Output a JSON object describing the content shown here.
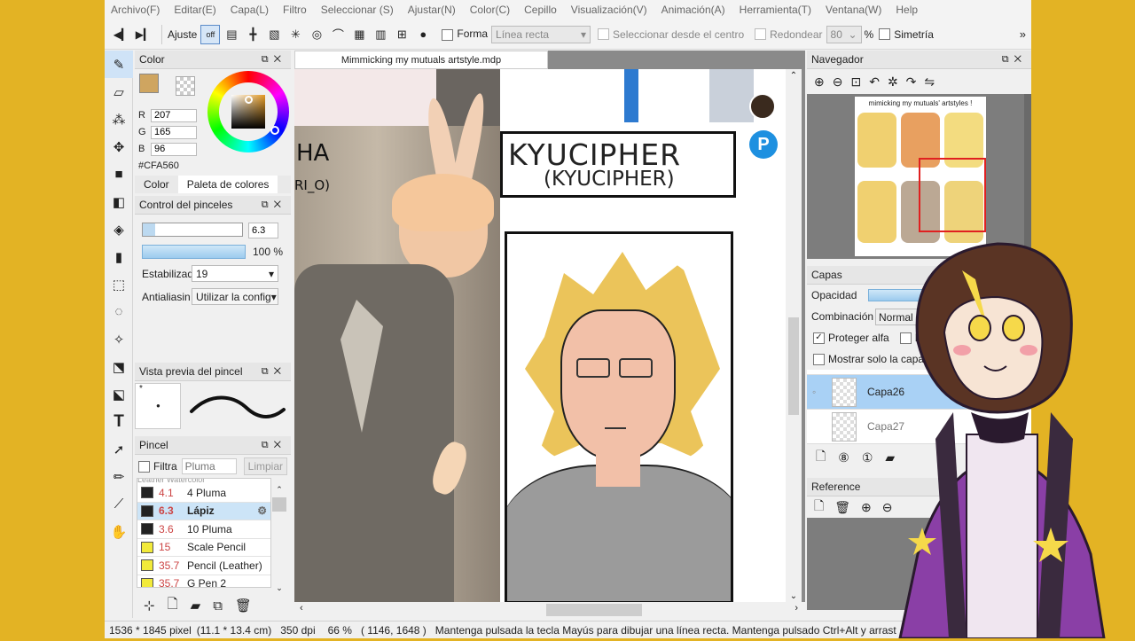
{
  "menu": [
    "Archivo(F)",
    "Editar(E)",
    "Capa(L)",
    "Filtro",
    "Seleccionar (S)",
    "Ajustar(N)",
    "Color(C)",
    "Cepillo",
    "Visualización(V)",
    "Animación(A)",
    "Herramienta(T)",
    "Ventana(W)",
    "Help"
  ],
  "toolbar": {
    "ajuste_label": "Ajuste",
    "off_label": "off",
    "forma_label": "Forma",
    "forma_value": "Línea recta",
    "select_from_center": "Seleccionar desde el centro",
    "redondear_label": "Redondear",
    "redondear_value": "80",
    "percent": "%",
    "simetria_label": "Simetría",
    "more": "»"
  },
  "document_tab": "Mimmicking my mutuals artstyle.mdp",
  "color_panel": {
    "title": "Color",
    "r_label": "R",
    "r": "207",
    "g_label": "G",
    "g": "165",
    "b_label": "B",
    "b": "96",
    "hex": "#CFA560",
    "tab_color": "Color",
    "tab_palette": "Paleta de colores",
    "fg_color": "#CFA560"
  },
  "brush_control": {
    "title": "Control del pinceles",
    "size": "6.3",
    "opacity": "100 %",
    "stabilizer_label": "Estabilizad",
    "stabilizer_value": "19",
    "antialias_label": "Antialiasin",
    "antialias_value": "Utilizar la config"
  },
  "brush_preview": {
    "title": "Vista previa del pincel"
  },
  "brush_panel": {
    "title": "Pincel",
    "filter_label": "Filtra",
    "filter_placeholder": "Pluma",
    "clear_label": "Limpiar",
    "partial_top": "Leather Watercolor",
    "items": [
      {
        "size": "4.1",
        "name": "4 Pluma",
        "color": "#222222"
      },
      {
        "size": "6.3",
        "name": "Lápiz",
        "color": "#222222"
      },
      {
        "size": "3.6",
        "name": "10 Pluma",
        "color": "#222222"
      },
      {
        "size": "15",
        "name": "Scale Pencil",
        "color": "#f2ea3a"
      },
      {
        "size": "35.7",
        "name": "Pencil (Leather)",
        "color": "#f2ea3a"
      },
      {
        "size": "35.7",
        "name": "G Pen 2",
        "color": "#f2ea3a"
      }
    ]
  },
  "navigator": {
    "title": "Navegador",
    "thumb_title": "mimicking my mutuals' artstyles !"
  },
  "layers": {
    "title": "Capas",
    "opacity_label": "Opacidad",
    "blend_label": "Combinación",
    "blend_value": "Normal",
    "protect_alpha": "Proteger alfa",
    "ref_label": "Re",
    "show_only": "Mostrar solo la capa a",
    "items": [
      {
        "name": "Capa26",
        "selected": true
      },
      {
        "name": "Capa27",
        "selected": false
      }
    ]
  },
  "reference": {
    "title": "Reference"
  },
  "canvas": {
    "name_title": "KYUCIPHER",
    "name_sub": "(KYUCIPHER)",
    "partial_left": "HA",
    "partial_left2": "RI_O)"
  },
  "status": {
    "size": "1536 * 1845 pixel",
    "cm": "(11.1 * 13.4 cm)",
    "dpi": "350 dpi",
    "zoom": "66 %",
    "coords": "( 1146, 1648 )",
    "hint": "Mantenga pulsada la tecla Mayús para dibujar una línea recta. Mantenga pulsado Ctrl+Alt y arrast"
  }
}
